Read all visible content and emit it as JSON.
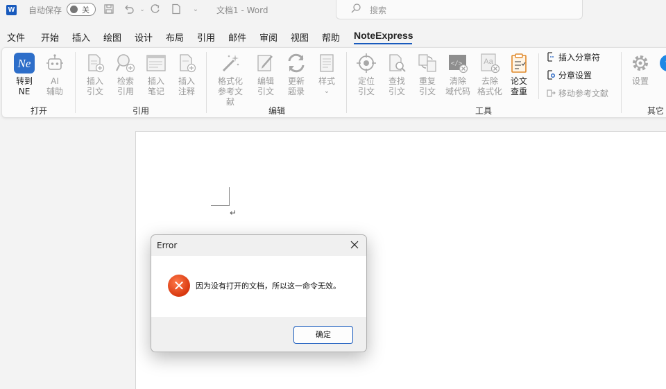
{
  "titlebar": {
    "logo": "W",
    "autosave_label": "自动保存",
    "autosave_state": "关",
    "doc_title": "文档1  -  Word",
    "search_placeholder": "搜索",
    "icons": [
      "save-icon",
      "undo-icon",
      "redo-icon",
      "new-doc-icon",
      "customize-icon"
    ]
  },
  "menu": {
    "tabs": [
      "文件",
      "开始",
      "插入",
      "绘图",
      "设计",
      "布局",
      "引用",
      "邮件",
      "审阅",
      "视图",
      "帮助",
      "NoteExpress"
    ],
    "active": "NoteExpress"
  },
  "ribbon": {
    "groups": {
      "open": "打开",
      "cite": "引用",
      "edit": "编辑",
      "tools": "工具",
      "other": "其它"
    },
    "buttons": {
      "goto_ne": "转到\nNE",
      "ai": "AI\n辅助",
      "insert_cite": "插入\n引文",
      "search_cite": "检索\n引用",
      "insert_note": "插入\n笔记",
      "insert_annot": "插入\n注释",
      "format_refs": "格式化\n参考文献",
      "edit_cite": "编辑\n引文",
      "update_bib": "更新\n题录",
      "style": "样式",
      "locate_cite": "定位\n引文",
      "find_cite": "查找\n引文",
      "dup_cite": "重复\n引文",
      "clear_field": "清除\n域代码",
      "remove_format": "去除\n格式化",
      "paper_check": "论文\n查重",
      "insert_chapter_break": "插入分章符",
      "chapter_settings": "分章设置",
      "move_refs": "移动参考文献",
      "settings": "设置"
    }
  },
  "dialog": {
    "title": "Error",
    "message": "因为没有打开的文档，所以这一命令无效。",
    "ok_label": "确定"
  },
  "colors": {
    "accent": "#185abd",
    "error": "#d8380f"
  }
}
